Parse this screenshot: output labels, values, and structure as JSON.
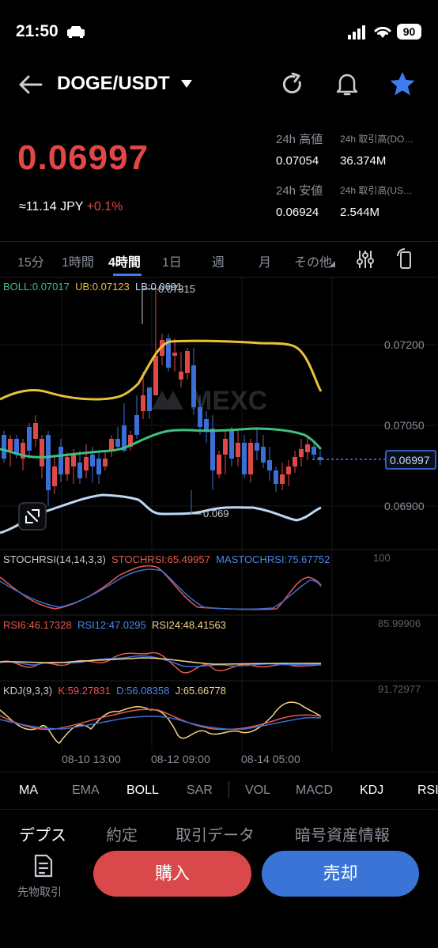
{
  "status_bar": {
    "time": "21:50",
    "battery": "90"
  },
  "header": {
    "pair": "DOGE/USDT"
  },
  "price": {
    "last": "0.06997",
    "approx": "≈11.14 JPY",
    "change": "+0.1%"
  },
  "stats": {
    "high_label": "24h 高値",
    "high_value": "0.07054",
    "vol_doge_label": "24h 取引高(DO…",
    "vol_doge_value": "36.374M",
    "low_label": "24h 安値",
    "low_value": "0.06924",
    "vol_usdt_label": "24h 取引高(US…",
    "vol_usdt_value": "2.544M"
  },
  "timeframes": [
    "15分",
    "1時間",
    "4時間",
    "1日",
    "週",
    "月",
    "その他"
  ],
  "chart": {
    "boll_legend": {
      "boll": "BOLL:0.07017",
      "ub": "UB:0.07123",
      "lb": "LB:0.0691"
    },
    "high_marker": "0.07315",
    "low_marker": "0.069",
    "y_ticks": [
      "0.07200",
      "0.07050",
      "0.06900"
    ],
    "current_price_tag": "0.06997",
    "watermark": "MEXC",
    "stochrsi_legend": {
      "params": "STOCHRSI(14,14,3,3)",
      "stoch": "STOCHRSI:65.49957",
      "ma": "MASTOCHRSI:75.67752"
    },
    "stochrsi_max": "100",
    "rsi_legend": {
      "rsi6": "RSI6:46.17328",
      "rsi12": "RSI12:47.0295",
      "rsi24": "RSI24:48.41563"
    },
    "rsi_max": "85.99906",
    "kdj_legend": {
      "params": "KDJ(9,3,3)",
      "k": "K:59.27831",
      "d": "D:56.08358",
      "j": "J:65.66778"
    },
    "kdj_max": "91.72977",
    "x_ticks": [
      "08-10 13:00",
      "08-12 09:00",
      "08-14 05:00"
    ]
  },
  "indicators": [
    "MA",
    "EMA",
    "BOLL",
    "SAR",
    "VOL",
    "MACD",
    "KDJ",
    "RSI"
  ],
  "bottom_tabs": [
    "デプス",
    "約定",
    "取引データ",
    "暗号資産情報"
  ],
  "actions": {
    "buy": "購入",
    "sell": "売却",
    "futures": "先物取引"
  },
  "colors": {
    "up": "#e04848",
    "down": "#3b6fd8",
    "accent": "#3d7df0",
    "boll_mid": "#3fc07f",
    "boll_upper": "#e8c23a",
    "boll_lower": "#bcd8f5"
  },
  "icons": {
    "back": "arrow-left-icon",
    "dropdown": "caret-down-icon",
    "refresh": "refresh-icon",
    "alert": "bell-icon",
    "favorite": "star-icon",
    "settings": "sliders-icon",
    "rotate": "rotate-screen-icon",
    "expand": "expand-icon",
    "futures": "document-icon"
  }
}
